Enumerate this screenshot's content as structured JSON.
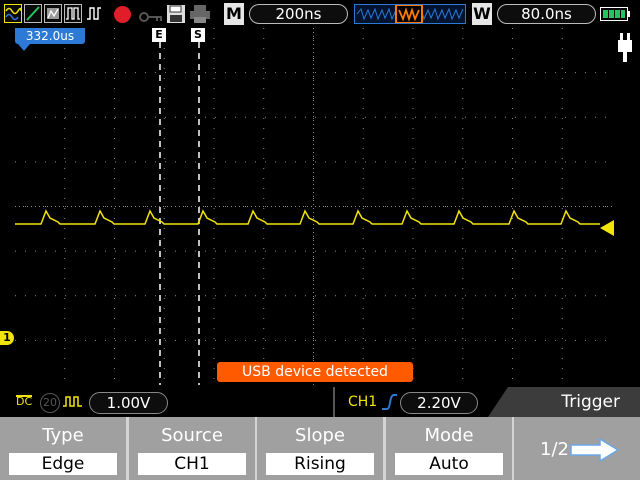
{
  "toolbar": {
    "icons": [
      "waveform-icon",
      "math-icon",
      "fft-icon",
      "pulse-icon",
      "record-icon",
      "key-icon",
      "save-icon",
      "print-icon",
      "battery-icon"
    ],
    "main_label": "M",
    "main_timebase": "200ns",
    "window_label": "W",
    "window_timebase": "80.0ns"
  },
  "screen": {
    "time_offset": "332.0us",
    "edge_labels": [
      "E",
      "S"
    ],
    "message": "USB device detected",
    "ch1_marker": "1",
    "colors": {
      "trace": "#f2e40a",
      "grid": "#8a8a8a",
      "message_bg": "#ff5a00",
      "time_marker_bg": "#2c79d6"
    }
  },
  "status": {
    "coupling": "DC",
    "bw_limit": "20",
    "probe_icon": "waveform-small-icon",
    "volts_div": "1.00V",
    "trigger_source": "CH1",
    "trigger_level": "2.20V",
    "menu_title": "Trigger"
  },
  "menu": {
    "items": [
      {
        "label": "Type",
        "value": "Edge"
      },
      {
        "label": "Source",
        "value": "CH1"
      },
      {
        "label": "Slope",
        "value": "Rising"
      },
      {
        "label": "Mode",
        "value": "Auto"
      }
    ],
    "page": "1/2"
  }
}
